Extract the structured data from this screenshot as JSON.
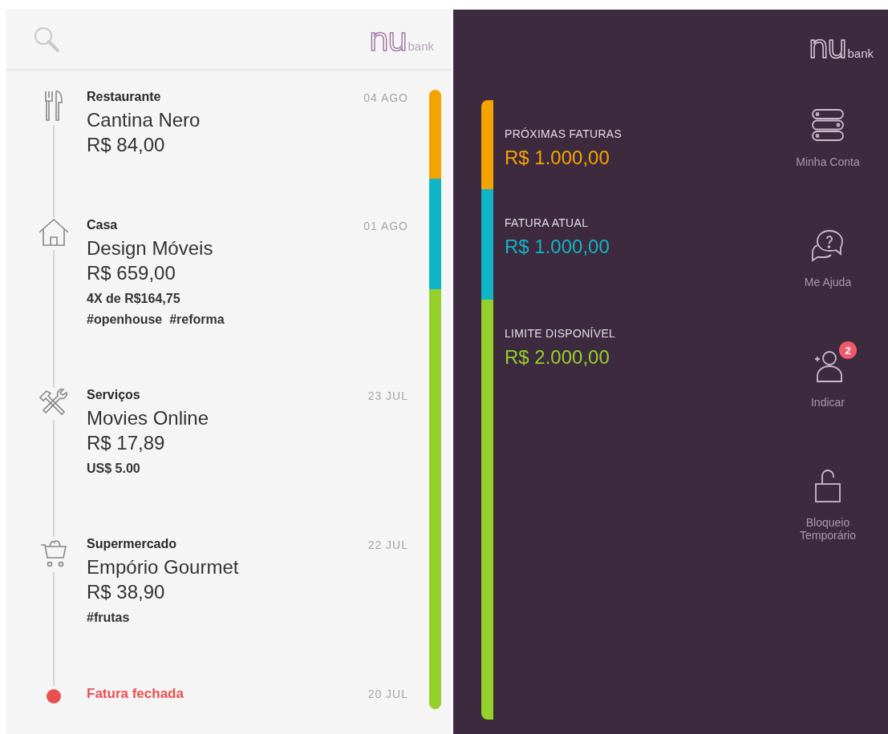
{
  "left_header": {
    "logo": {
      "mark": "nu",
      "word": "bank"
    }
  },
  "timeline": [
    {
      "kind": "restaurant",
      "category": "Restaurante",
      "merchant": "Cantina Nero",
      "amount": "R$ 84,00",
      "date": "04 AGO"
    },
    {
      "kind": "home",
      "category": "Casa",
      "merchant": "Design Móveis",
      "amount": "R$ 659,00",
      "notes": [
        "4X de R$164,75",
        "#openhouse  #reforma"
      ],
      "date": "01 AGO"
    },
    {
      "kind": "services",
      "category": "Serviços",
      "merchant": "Movies Online",
      "amount": "R$ 17,89",
      "notes": [
        "US$ 5.00"
      ],
      "date": "23 JUL"
    },
    {
      "kind": "grocery",
      "category": "Supermercado",
      "merchant": "Empório Gourmet",
      "amount": "R$ 38,90",
      "notes": [
        "#frutas"
      ],
      "date": "22 JUL"
    },
    {
      "kind": "closing",
      "category": "Fatura fechada",
      "date": "20 JUL"
    }
  ],
  "right_header": {
    "logo": {
      "mark": "nu",
      "word": "bank"
    }
  },
  "summary": [
    {
      "label": "PRÓXIMAS FATURAS",
      "amount": "R$ 1.000,00",
      "color": "#f5a300",
      "level": 0.143
    },
    {
      "label": "FATURA ATUAL",
      "amount": "R$ 1.000,00",
      "color": "#10b5c6",
      "level": 0.179
    },
    {
      "label": "LIMITE DISPONÍVEL",
      "amount": "R$ 2.000,00",
      "color": "#96d02b",
      "level": 0.678
    }
  ],
  "nav": [
    {
      "kind": "account",
      "label": "Minha Conta"
    },
    {
      "kind": "help",
      "label": "Me Ajuda"
    },
    {
      "kind": "refer",
      "label": "Indicar",
      "badge": "2"
    },
    {
      "kind": "lock",
      "label": "Bloqueio Temporário"
    }
  ]
}
